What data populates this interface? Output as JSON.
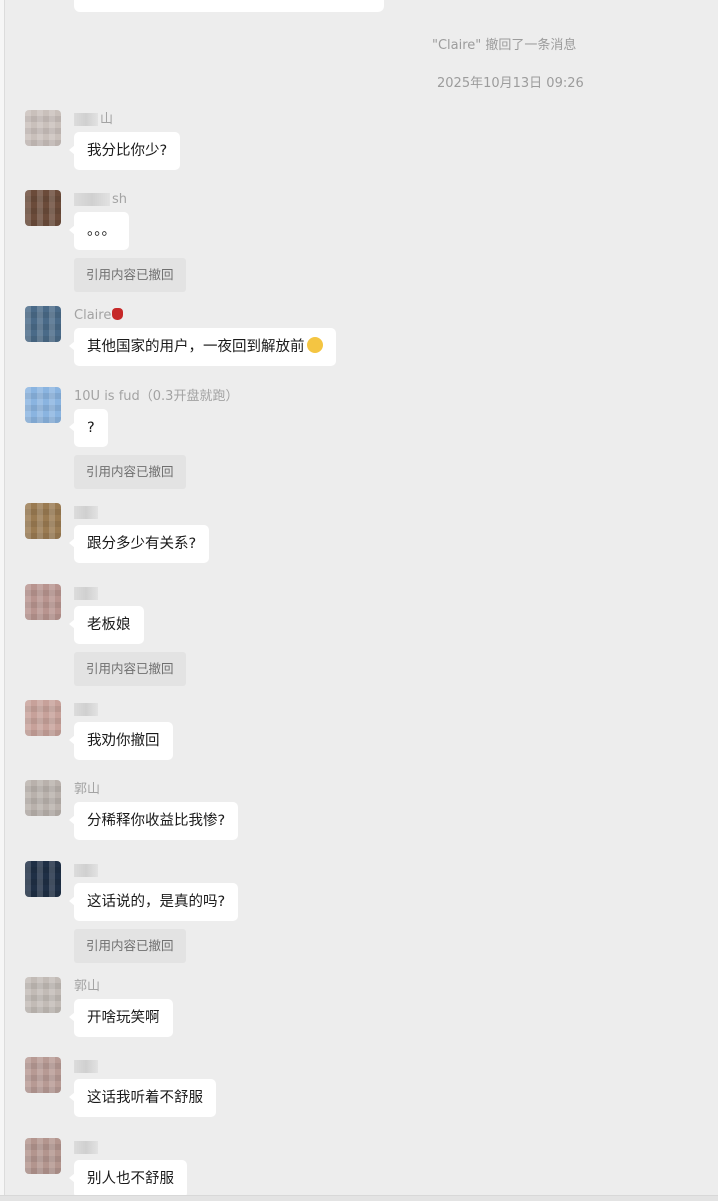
{
  "system": {
    "recall_notice": "\"Claire\" 撤回了一条消息",
    "timestamp": "2025年10月13日 09:26"
  },
  "quote_text": "引用内容已撤回",
  "messages": [
    {
      "sender": "山",
      "text": "我分比你少?",
      "avatar_color": "#c9c0bb"
    },
    {
      "sender": "sh",
      "text": "。。。",
      "avatar_color": "#6b4b3a"
    },
    {
      "sender": "Claire",
      "text": "其他国家的用户，一夜回到解放前",
      "avatar_color": "#4a6a88"
    },
    {
      "sender": "10U is fud（0.3开盘就跑）",
      "text": "?",
      "avatar_color": "#8ab4e0"
    },
    {
      "sender": "",
      "text": "跟分多少有关系?",
      "avatar_color": "#9a7b52"
    },
    {
      "sender": "",
      "text": "老板娘",
      "avatar_color": "#b8948f"
    },
    {
      "sender": "",
      "text": "我劝你撤回",
      "avatar_color": "#c7a19a"
    },
    {
      "sender": "郭山",
      "text": "分稀释你收益比我惨?",
      "avatar_color": "#b9b1ac"
    },
    {
      "sender": "",
      "text": "这话说的，是真的吗?",
      "avatar_color": "#1f2f45"
    },
    {
      "sender": "郭山",
      "text": "开啥玩笑啊",
      "avatar_color": "#c2bbb6"
    },
    {
      "sender": "",
      "text": "这话我听着不舒服",
      "avatar_color": "#b79a94"
    },
    {
      "sender": "",
      "text": "别人也不舒服",
      "avatar_color": "#b3958e"
    }
  ],
  "icons": {
    "emoji": "sad-face-emoji",
    "red_badge": "red-bag-emoji"
  }
}
